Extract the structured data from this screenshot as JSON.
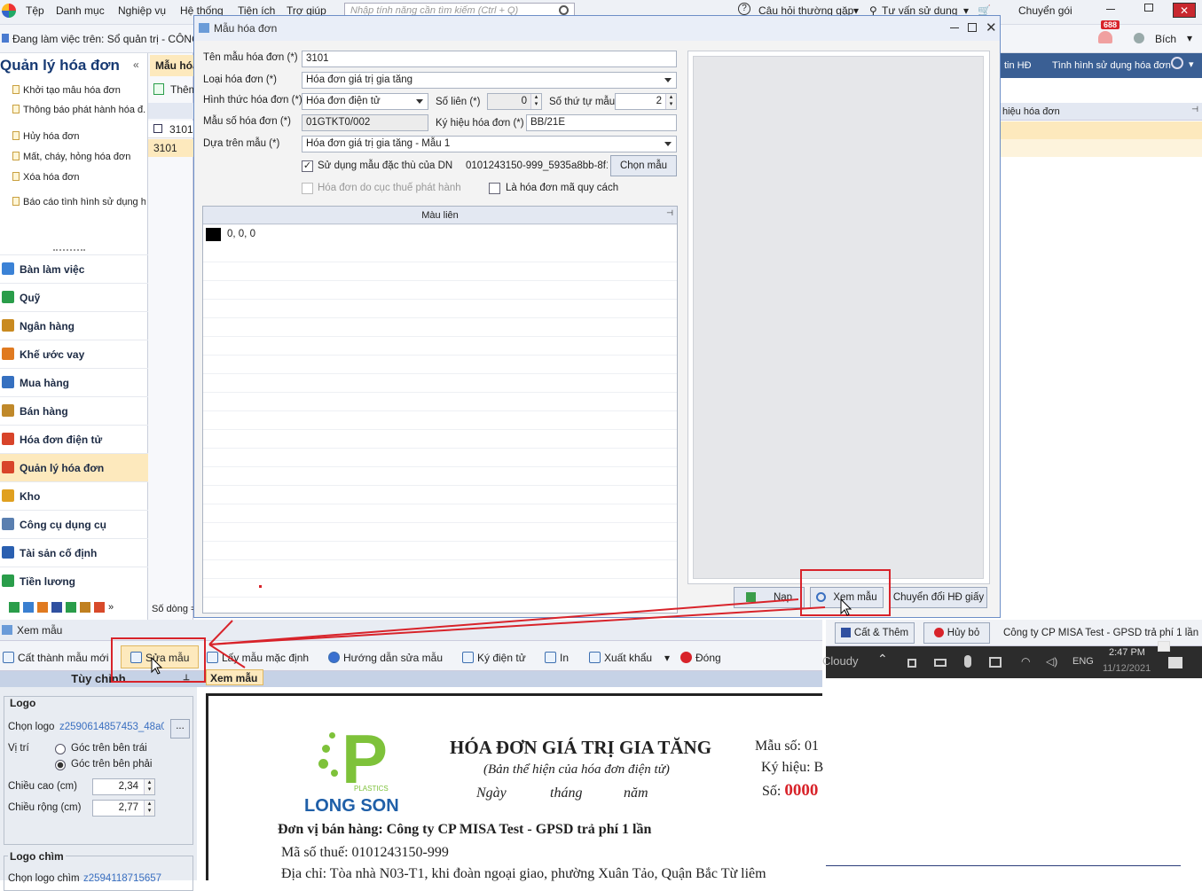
{
  "menubar": {
    "items": [
      "Tệp",
      "Danh mục",
      "Nghiệp vụ",
      "Hệ thống",
      "Tiện ích",
      "Trợ giúp"
    ],
    "search_placeholder": "Nhập tính năng cần tìm kiếm (Ctrl + Q)",
    "faq": "Câu hỏi thường gặp",
    "advice": "Tư vấn sử dụng",
    "plan": "Chuyển gói",
    "badge": "688",
    "user": "Bích"
  },
  "subbar": {
    "working_on": "Đang làm việc trên: Sổ quản trị - CÔNG"
  },
  "sidebar": {
    "title": "Quản lý hóa đơn",
    "tasks": [
      "Khởi tạo mẫu hóa đơn",
      "Thông báo phát hành hóa đ..",
      "Hủy hóa đơn",
      "Mất, cháy, hỏng hóa đơn",
      "Xóa hóa đơn",
      "Báo cáo tình hình sử dụng h.."
    ],
    "nav": [
      "Bàn làm việc",
      "Quỹ",
      "Ngân hàng",
      "Khế ước vay",
      "Mua hàng",
      "Bán hàng",
      "Hóa đơn điện tử",
      "Quản lý hóa đơn",
      "Kho",
      "Công cụ dụng cụ",
      "Tài sản cố định",
      "Tiền lương"
    ]
  },
  "bg": {
    "tab": "Mẫu hóa",
    "add": "Thêm",
    "row1": "3101",
    "row2": "3101",
    "footer": "Số dòng =",
    "right_tab1": "tin HĐ",
    "right_tab2": "Tình hình sử dụng hóa đơn",
    "right_col": "hiệu hóa đơn"
  },
  "dialog": {
    "title": "Mẫu hóa đơn",
    "ten_mau_label": "Tên mẫu hóa đơn (*)",
    "ten_mau": "3101",
    "loai_label": "Loại hóa đơn (*)",
    "loai": "Hóa đơn giá trị gia tăng",
    "hinh_thuc_label": "Hình thức hóa đơn (*)",
    "hinh_thuc": "Hóa đơn điện tử",
    "so_lien_label": "Số liên (*)",
    "so_lien": "0",
    "so_thu_tu_label": "Số thứ tự mẫu",
    "so_thu_tu": "2",
    "mau_so_label": "Mẫu số hóa đơn (*)",
    "mau_so": "01GTKT0/002",
    "ky_hieu_label": "Ký hiệu hóa đơn (*)",
    "ky_hieu": "BB/21E",
    "dua_tren_label": "Dựa trên mẫu (*)",
    "dua_tren": "Hóa đơn giá trị gia tăng - Mẫu 1",
    "dac_thu_label": "Sử dụng mẫu đặc thù của DN",
    "dac_thu_file": "0101243150-999_5935a8bb-8f1",
    "chon_mau": "Chọn mẫu",
    "cuc_thue": "Hóa đơn do cục thuế phát hành",
    "quy_cach": "Là hóa đơn mã quy cách",
    "mau_lien_header": "Màu liên",
    "mau_lien_row": "0, 0, 0",
    "nap": "Nạp",
    "xem_mau": "Xem mẫu",
    "chuyen_doi": "Chuyển đổi HĐ giấy",
    "cat_them": "Cất & Thêm",
    "huy_bo": "Hủy bỏ"
  },
  "taskbar": {
    "company": "Công ty CP MISA Test - GPSD trả phí 1 lần",
    "weather": "Cloudy",
    "lang": "ENG",
    "time": "2:47 PM",
    "date": "11/12/2021"
  },
  "preview": {
    "title": "Xem mẫu",
    "toolbar": [
      "Cất thành mẫu mới",
      "Sửa mẫu",
      "Lấy mẫu mặc định",
      "Hướng dẫn sửa mẫu",
      "Ký điện tử",
      "In",
      "Xuất khẩu",
      "Đóng"
    ],
    "tab_custom": "Tùy chỉnh",
    "tab_preview": "Xem mẫu",
    "logo_group": "Logo",
    "chon_logo_label": "Chọn logo",
    "chon_logo_value": "z2590614857453_48a0",
    "vi_tri_label": "Vị trí",
    "pos_left": "Góc trên bên trái",
    "pos_right": "Góc trên bên phải",
    "cao_label": "Chiều cao (cm)",
    "cao": "2,34",
    "rong_label": "Chiều rộng (cm)",
    "rong": "2,77",
    "logo_chim": "Logo chìm",
    "chon_logo_chim": "Chọn logo chìm",
    "chon_logo_chim_value": "z2594118715657"
  },
  "invoice": {
    "logo_p": "P",
    "logo_small": "PLASTICS",
    "logo_text": "LONG SON",
    "title": "HÓA ĐƠN GIÁ TRỊ GIA TĂNG",
    "subtitle": "(Bản thể hiện của hóa đơn điện tử)",
    "ngay": "Ngày",
    "thang": "tháng",
    "nam": "năm",
    "mau_so": "Mẫu số:",
    "mau_so_val": "01",
    "ky_hieu": "Ký hiệu:",
    "ky_hieu_val": "B",
    "so": "Số:",
    "so_val": "0000",
    "seller": "Đơn vị bán hàng: Công ty CP MISA Test - GPSD trả phí 1 lần",
    "mst": "Mã số thuế:",
    "mst_val": "0101243150-999",
    "address": "Địa chỉ: Tòa nhà N03-T1, khi đoàn ngoại giao, phường Xuân Tảo, Quận Bắc Từ liêm"
  },
  "colors": {
    "accent": "#d8232a",
    "nav_active": "#fde9bd",
    "brand": "#173a73"
  }
}
